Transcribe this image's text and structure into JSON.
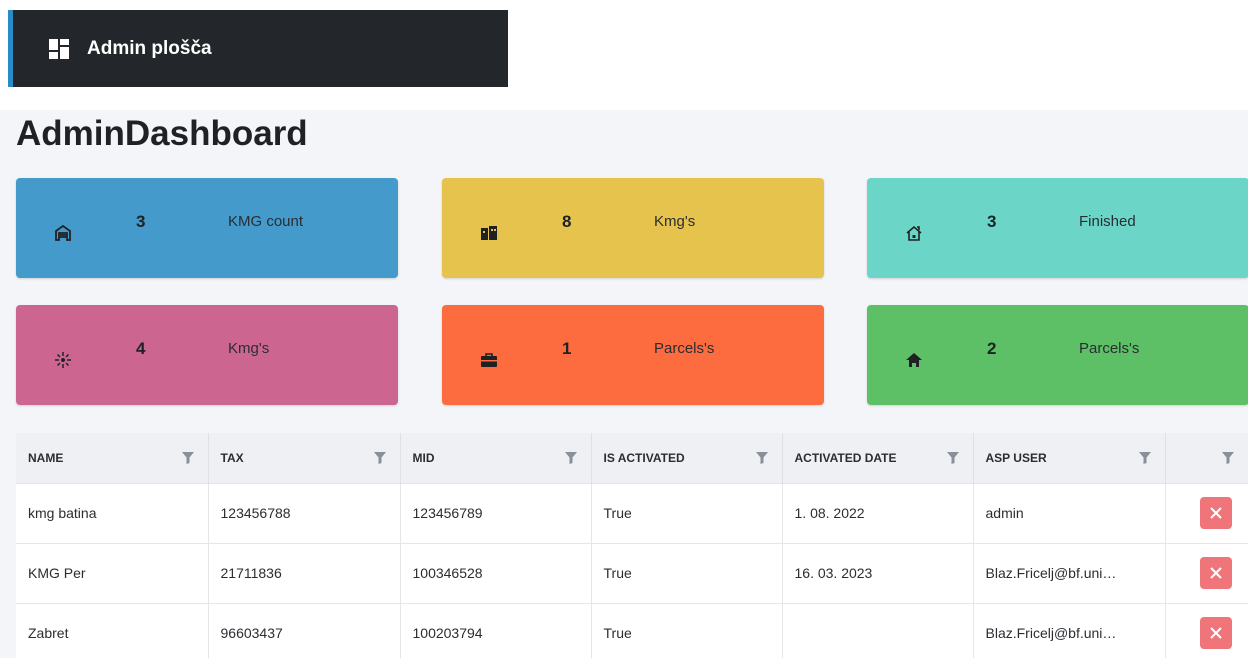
{
  "topbar": {
    "title": "Admin plošča",
    "accent": "#2a8cc7",
    "icon": "dashboard-icon"
  },
  "page": {
    "title": "AdminDashboard"
  },
  "cards": [
    {
      "count": "3",
      "label": "KMG count",
      "color": "#449bcb",
      "icon": "warehouse-icon"
    },
    {
      "count": "8",
      "label": "Kmg's",
      "color": "#e6c34c",
      "icon": "buildings-icon"
    },
    {
      "count": "3",
      "label": "Finished",
      "color": "#6bd6c8",
      "icon": "home-outline-icon"
    },
    {
      "count": "4",
      "label": "Kmg's",
      "color": "#cc6690",
      "icon": "sparkle-icon"
    },
    {
      "count": "1",
      "label": "Parcels's",
      "color": "#fd6c3f",
      "icon": "toolbox-icon"
    },
    {
      "count": "2",
      "label": "Parcels's",
      "color": "#5dbf66",
      "icon": "home-icon"
    }
  ],
  "table": {
    "columns": [
      "NAME",
      "TAX",
      "MID",
      "IS ACTIVATED",
      "ACTIVATED DATE",
      "ASP USER",
      ""
    ],
    "rows": [
      [
        "kmg batina",
        "123456788",
        "123456789",
        "True",
        "1. 08. 2022",
        "admin"
      ],
      [
        "KMG Per",
        "21711836",
        "100346528",
        "True",
        "16. 03. 2023",
        "Blaz.Fricelj@bf.uni…"
      ],
      [
        "Zabret",
        "96603437",
        "100203794",
        "True",
        "",
        "Blaz.Fricelj@bf.uni…"
      ]
    ],
    "delete_color": "#f0757a"
  }
}
